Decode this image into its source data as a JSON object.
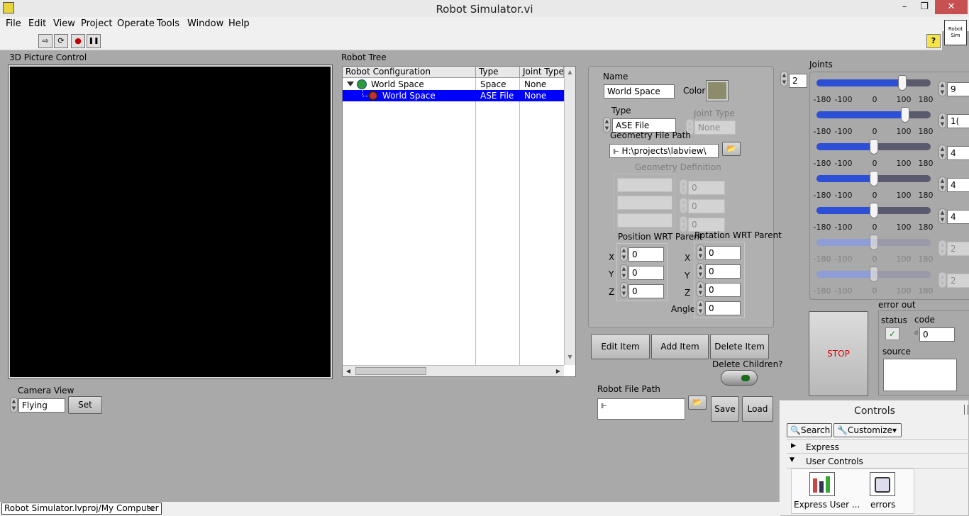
{
  "window": {
    "title": "Robot Simulator.vi",
    "minimize": "–",
    "maximize": "❐",
    "close": "✕"
  },
  "menu": [
    "File",
    "Edit",
    "View",
    "Project",
    "Operate",
    "Tools",
    "Window",
    "Help"
  ],
  "toolbar": {
    "run": "⇨",
    "run_continuous": "⟳",
    "abort": "●",
    "pause": "❚❚",
    "help": "?",
    "vi_icon": "Robot Sim"
  },
  "picture": {
    "label": "3D Picture Control"
  },
  "camera": {
    "label": "Camera View",
    "value": "Flying",
    "set_label": "Set"
  },
  "tree": {
    "label": "Robot Tree",
    "columns": [
      "Robot Configuration",
      "Type",
      "Joint Type"
    ],
    "rows": [
      {
        "name": "World Space",
        "type": "Space",
        "joint": "None"
      },
      {
        "name": "World Space",
        "type": "ASE File",
        "joint": "None"
      }
    ]
  },
  "props": {
    "name_label": "Name",
    "name_value": "World Space",
    "color_label": "Color",
    "color_value": "#8c8c6c",
    "type_label": "Type",
    "type_value": "ASE File",
    "joint_type_label": "Joint Type",
    "joint_type_value": "None",
    "geom_path_label": "Geometry File Path",
    "geom_path_value": "H:\\projects\\labview\\",
    "geom_def_label": "Geometry Definition",
    "geom_def_values": [
      "0",
      "0",
      "0"
    ],
    "pos_label": "Position WRT Parent",
    "rot_label": "Rotation WRT Parent",
    "x": "X",
    "y": "Y",
    "z": "Z",
    "angle": "Angle",
    "pos_values": [
      "0",
      "0",
      "0"
    ],
    "rot_values": [
      "0",
      "0",
      "0",
      "0"
    ]
  },
  "actions": {
    "edit": "Edit Item",
    "add": "Add Item",
    "delete": "Delete Item",
    "delete_children": "Delete Children?"
  },
  "file": {
    "label": "Robot File Path",
    "value": "",
    "save": "Save",
    "load": "Load"
  },
  "joints": {
    "label": "Joints",
    "count": "2",
    "ticks": [
      "-180",
      "-100",
      "0",
      "100",
      "180"
    ],
    "sliders": [
      {
        "value": 90,
        "readout": "9",
        "enabled": true
      },
      {
        "value": 100,
        "readout": "1(",
        "enabled": true
      },
      {
        "value": 0,
        "readout": "4",
        "enabled": true
      },
      {
        "value": 0,
        "readout": "4",
        "enabled": true
      },
      {
        "value": 0,
        "readout": "4",
        "enabled": true
      },
      {
        "value": 0,
        "readout": "2",
        "enabled": false
      },
      {
        "value": 0,
        "readout": "2",
        "enabled": false
      }
    ]
  },
  "stop": {
    "label": "STOP"
  },
  "error": {
    "label": "error out",
    "status_label": "status",
    "code_label": "code",
    "code_value": "0",
    "source_label": "source",
    "status_check": "✓",
    "code_radix": "d"
  },
  "palette": {
    "title": "Controls",
    "search": "Search",
    "customize": "Customize▾",
    "sections": [
      {
        "label": "Express",
        "arrow": "▶"
      },
      {
        "label": "User Controls",
        "arrow": "▼"
      }
    ],
    "items": [
      "Express User ...",
      "errors"
    ]
  },
  "statusbar": {
    "text": "Robot Simulator.lvproj/My Computer",
    "arrow": "<"
  }
}
